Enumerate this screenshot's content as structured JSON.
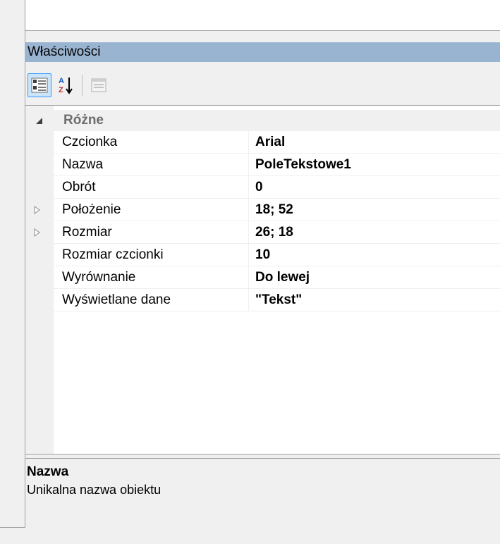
{
  "panel": {
    "title": "Właściwości"
  },
  "toolbar": {
    "categorized": "categorized-icon",
    "alphabetical": "sort-alphabetical-icon",
    "property_pages": "property-pages-icon"
  },
  "category": {
    "label": "Różne",
    "expanded": true
  },
  "properties": [
    {
      "name": "Czcionka",
      "value": "Arial",
      "expandable": false
    },
    {
      "name": "Nazwa",
      "value": "PoleTekstowe1",
      "expandable": false
    },
    {
      "name": "Obrót",
      "value": "0",
      "expandable": false
    },
    {
      "name": "Położenie",
      "value": "18; 52",
      "expandable": true
    },
    {
      "name": "Rozmiar",
      "value": "26; 18",
      "expandable": true
    },
    {
      "name": "Rozmiar czcionki",
      "value": "10",
      "expandable": false
    },
    {
      "name": "Wyrównanie",
      "value": "Do lewej",
      "expandable": false
    },
    {
      "name": "Wyświetlane dane",
      "value": "\"Tekst\"",
      "expandable": false
    }
  ],
  "description": {
    "title": "Nazwa",
    "text": "Unikalna nazwa obiektu"
  },
  "colors": {
    "header_bg": "#99b4d1",
    "selected_button_bg": "#cce4f7",
    "selected_button_border": "#3399ff"
  }
}
